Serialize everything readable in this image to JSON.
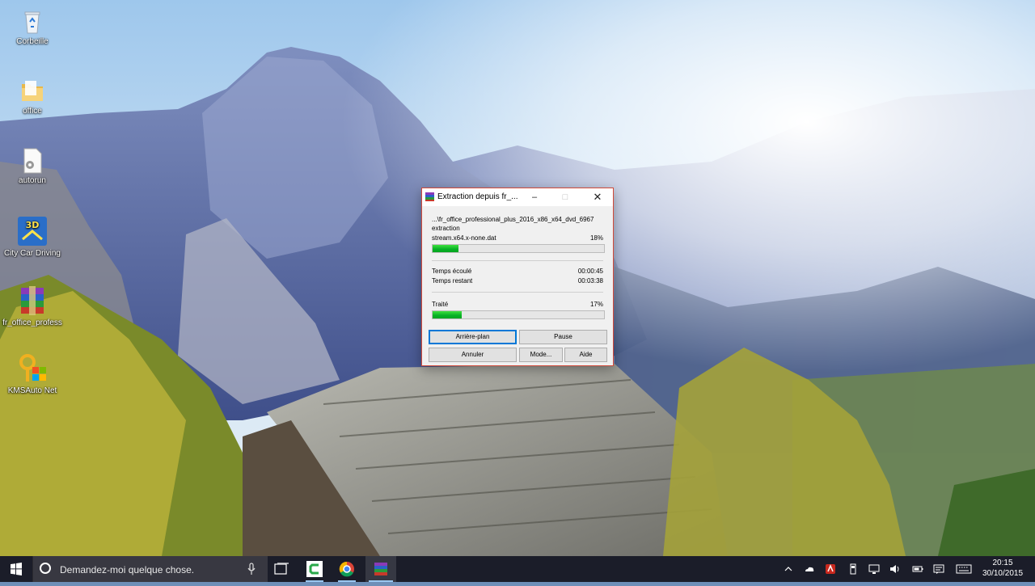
{
  "desktop": {
    "icons": [
      {
        "label": "Corbeille",
        "icon": "recycle-bin-icon"
      },
      {
        "label": "office",
        "icon": "folder-icon"
      },
      {
        "label": "autorun",
        "icon": "file-settings-icon"
      },
      {
        "label": "City Car Driving",
        "icon": "car-app-icon"
      },
      {
        "label": "fr_office_profess",
        "icon": "archive-icon"
      },
      {
        "label": "KMSAuto Net",
        "icon": "kms-tool-icon"
      }
    ]
  },
  "dialog": {
    "title": "Extraction depuis fr_...",
    "archive_path": "...\\fr_office_professional_plus_2016_x86_x64_dvd_6967",
    "action": "extraction",
    "current_file": "stream.x64.x-none.dat",
    "file_percent_label": "18%",
    "file_progress": 0.15,
    "elapsed_label": "Temps écoulé",
    "elapsed_value": "00:00:45",
    "remaining_label": "Temps restant",
    "remaining_value": "00:03:38",
    "processed_label": "Traité",
    "processed_percent_label": "17%",
    "processed_progress": 0.17,
    "buttons": {
      "background": "Arrière-plan",
      "pause": "Pause",
      "cancel": "Annuler",
      "mode": "Mode...",
      "help": "Aide"
    }
  },
  "taskbar": {
    "search_placeholder": "Demandez-moi quelque chose.",
    "clock_time": "20:15",
    "clock_date": "30/10/2015",
    "apps": [
      "camtasia-icon",
      "chrome-icon",
      "winrar-icon"
    ]
  },
  "colors": {
    "progress_green": "#06b025",
    "dialog_border": "#d04a3a",
    "default_button_border": "#0078d7"
  }
}
